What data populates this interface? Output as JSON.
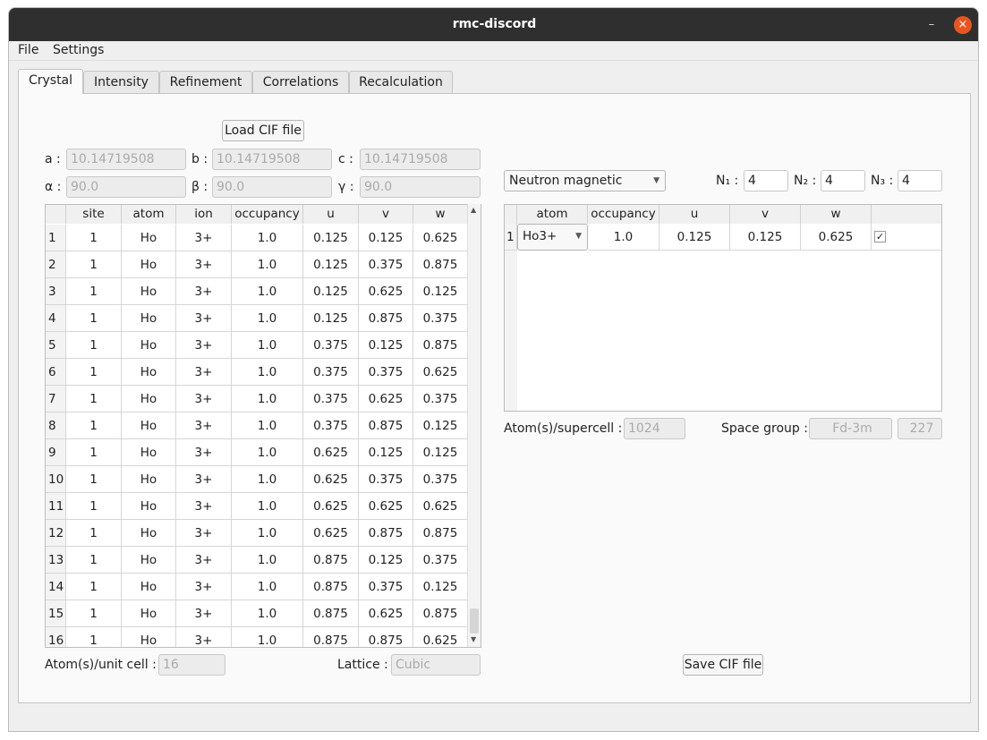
{
  "window": {
    "title": "rmc-discord",
    "controls": {
      "minimize": "–",
      "maximize": "□",
      "close": "×"
    }
  },
  "menu": [
    "File",
    "Settings"
  ],
  "tabs": [
    "Crystal",
    "Intensity",
    "Refinement",
    "Correlations",
    "Recalculation"
  ],
  "active_tab": "Crystal",
  "crystal": {
    "load_button": "Load CIF file",
    "save_button": "Save CIF file",
    "params": [
      {
        "label": "a :",
        "value": "10.14719508"
      },
      {
        "label": "b :",
        "value": "10.14719508"
      },
      {
        "label": "c :",
        "value": "10.14719508"
      },
      {
        "label": "α :",
        "value": "90.0"
      },
      {
        "label": "β :",
        "value": "90.0"
      },
      {
        "label": "γ :",
        "value": "90.0"
      }
    ],
    "atom_table": {
      "columns": [
        "site",
        "atom",
        "ion",
        "occupancy",
        "u",
        "v",
        "w"
      ],
      "rows": [
        [
          "1",
          "1",
          "Ho",
          "3+",
          "1.0",
          "0.125",
          "0.125",
          "0.625"
        ],
        [
          "2",
          "1",
          "Ho",
          "3+",
          "1.0",
          "0.125",
          "0.375",
          "0.875"
        ],
        [
          "3",
          "1",
          "Ho",
          "3+",
          "1.0",
          "0.125",
          "0.625",
          "0.125"
        ],
        [
          "4",
          "1",
          "Ho",
          "3+",
          "1.0",
          "0.125",
          "0.875",
          "0.375"
        ],
        [
          "5",
          "1",
          "Ho",
          "3+",
          "1.0",
          "0.375",
          "0.125",
          "0.875"
        ],
        [
          "6",
          "1",
          "Ho",
          "3+",
          "1.0",
          "0.375",
          "0.375",
          "0.625"
        ],
        [
          "7",
          "1",
          "Ho",
          "3+",
          "1.0",
          "0.375",
          "0.625",
          "0.375"
        ],
        [
          "8",
          "1",
          "Ho",
          "3+",
          "1.0",
          "0.375",
          "0.875",
          "0.125"
        ],
        [
          "9",
          "1",
          "Ho",
          "3+",
          "1.0",
          "0.625",
          "0.125",
          "0.125"
        ],
        [
          "10",
          "1",
          "Ho",
          "3+",
          "1.0",
          "0.625",
          "0.375",
          "0.375"
        ],
        [
          "11",
          "1",
          "Ho",
          "3+",
          "1.0",
          "0.625",
          "0.625",
          "0.625"
        ],
        [
          "12",
          "1",
          "Ho",
          "3+",
          "1.0",
          "0.625",
          "0.875",
          "0.875"
        ],
        [
          "13",
          "1",
          "Ho",
          "3+",
          "1.0",
          "0.875",
          "0.125",
          "0.375"
        ],
        [
          "14",
          "1",
          "Ho",
          "3+",
          "1.0",
          "0.875",
          "0.375",
          "0.125"
        ],
        [
          "15",
          "1",
          "Ho",
          "3+",
          "1.0",
          "0.875",
          "0.625",
          "0.875"
        ],
        [
          "16",
          "1",
          "Ho",
          "3+",
          "1.0",
          "0.875",
          "0.875",
          "0.625"
        ]
      ]
    },
    "atoms_unit_cell": {
      "label": "Atom(s)/unit cell :",
      "value": "16"
    },
    "lattice": {
      "label": "Lattice :",
      "value": "Cubic"
    },
    "type_select": "Neutron magnetic",
    "supercell": [
      {
        "label": "N₁ :",
        "value": "4"
      },
      {
        "label": "N₂ :",
        "value": "4"
      },
      {
        "label": "N₃ :",
        "value": "4"
      }
    ],
    "unique_table": {
      "columns": [
        "atom",
        "occupancy",
        "u",
        "v",
        "w",
        ""
      ],
      "rows": [
        {
          "index": "1",
          "atom": "Ho3+",
          "occupancy": "1.0",
          "u": "0.125",
          "v": "0.125",
          "w": "0.625",
          "checked": true,
          "check_glyph": "✓"
        }
      ]
    },
    "atoms_supercell": {
      "label": "Atom(s)/supercell :",
      "value": "1024"
    },
    "space_group": {
      "label": "Space group :",
      "symbol": "Fd-3m",
      "number": "227"
    }
  }
}
